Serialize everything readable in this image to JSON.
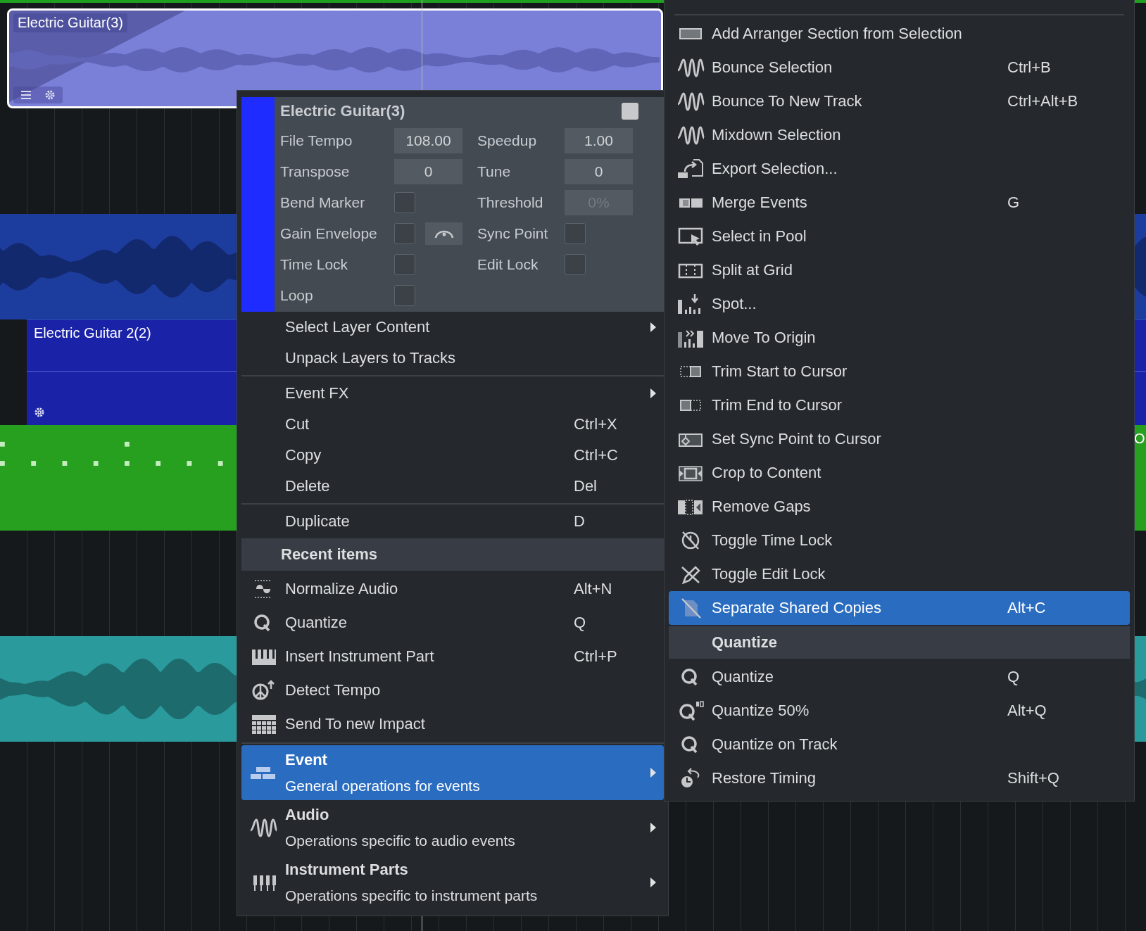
{
  "tracks": [
    {
      "kind": "event",
      "color": "#7a80d8",
      "label": "Electric Guitar(3)",
      "selected": true
    },
    {
      "kind": "empty"
    },
    {
      "kind": "waveform",
      "color": "#1c3c9e"
    },
    {
      "kind": "part",
      "color": "#1a22a8",
      "label": "Electric Guitar 2(2)"
    },
    {
      "kind": "notes",
      "color": "#27a020",
      "edge_label": "O"
    },
    {
      "kind": "empty"
    },
    {
      "kind": "waveform",
      "color": "#2a9a9c"
    },
    {
      "kind": "empty"
    }
  ],
  "event_panel": {
    "title": "Electric Guitar(3)",
    "color": "#1f2cff",
    "fields": [
      {
        "label": "File Tempo",
        "kind": "value",
        "value": "108.00",
        "disabled": false
      },
      {
        "label": "Speedup",
        "kind": "value",
        "value": "1.00",
        "disabled": false
      },
      {
        "label": "Transpose",
        "kind": "value",
        "value": "0",
        "disabled": false
      },
      {
        "label": "Tune",
        "kind": "value",
        "value": "0",
        "disabled": false
      },
      {
        "label": "Bend Marker",
        "kind": "checkbox",
        "checked": false
      },
      {
        "label": "Threshold",
        "kind": "value",
        "value": "0%",
        "disabled": true
      },
      {
        "label": "Gain Envelope",
        "kind": "checkbox",
        "checked": false,
        "curve_button": true
      },
      {
        "label": "Sync Point",
        "kind": "checkbox",
        "checked": false
      },
      {
        "label": "Time Lock",
        "kind": "checkbox",
        "checked": false
      },
      {
        "label": "Edit Lock",
        "kind": "checkbox",
        "checked": false
      },
      {
        "label": "Loop",
        "kind": "checkbox",
        "checked": false
      }
    ]
  },
  "context_menu": {
    "items": [
      {
        "kind": "item",
        "label": "Select Layer Content",
        "submenu": true,
        "selected": false
      },
      {
        "kind": "item",
        "label": "Unpack Layers to Tracks",
        "submenu": false,
        "selected": false
      },
      {
        "kind": "separator"
      },
      {
        "kind": "item",
        "label": "Event FX",
        "submenu": true,
        "selected": false
      },
      {
        "kind": "item",
        "label": "Cut",
        "shortcut": "Ctrl+X",
        "submenu": false,
        "selected": false
      },
      {
        "kind": "item",
        "label": "Copy",
        "shortcut": "Ctrl+C",
        "submenu": false,
        "selected": false
      },
      {
        "kind": "item",
        "label": "Delete",
        "shortcut": "Del",
        "submenu": false,
        "selected": false
      },
      {
        "kind": "separator"
      },
      {
        "kind": "item",
        "label": "Duplicate",
        "shortcut": "D",
        "submenu": false,
        "selected": false
      },
      {
        "kind": "header",
        "label": "Recent items"
      },
      {
        "kind": "item",
        "label": "Normalize Audio",
        "shortcut": "Alt+N",
        "submenu": false,
        "selected": false
      },
      {
        "kind": "item",
        "label": "Quantize",
        "shortcut": "Q",
        "submenu": false,
        "selected": false
      },
      {
        "kind": "item",
        "label": "Insert Instrument Part",
        "shortcut": "Ctrl+P",
        "submenu": false,
        "selected": false
      },
      {
        "kind": "item",
        "label": "Detect Tempo",
        "submenu": false,
        "selected": false
      },
      {
        "kind": "item",
        "label": "Send To new Impact",
        "submenu": false,
        "selected": false
      },
      {
        "kind": "separator"
      },
      {
        "kind": "category",
        "label": "Event",
        "description": "General operations for events",
        "submenu": true,
        "selected": true
      },
      {
        "kind": "category",
        "label": "Audio",
        "description": "Operations specific to audio events",
        "submenu": true,
        "selected": false
      },
      {
        "kind": "category",
        "label": "Instrument Parts",
        "description": "Operations specific to instrument parts",
        "submenu": true,
        "selected": false
      }
    ]
  },
  "submenu": {
    "items": [
      {
        "kind": "separator"
      },
      {
        "kind": "item",
        "label": "Add Arranger Section from Selection",
        "selected": false
      },
      {
        "kind": "item",
        "label": "Bounce Selection",
        "shortcut": "Ctrl+B",
        "selected": false
      },
      {
        "kind": "item",
        "label": "Bounce To New Track",
        "shortcut": "Ctrl+Alt+B",
        "selected": false
      },
      {
        "kind": "item",
        "label": "Mixdown Selection",
        "selected": false
      },
      {
        "kind": "item",
        "label": "Export Selection...",
        "selected": false
      },
      {
        "kind": "item",
        "label": "Merge Events",
        "shortcut": "G",
        "selected": false
      },
      {
        "kind": "item",
        "label": "Select in Pool",
        "selected": false
      },
      {
        "kind": "item",
        "label": "Split at Grid",
        "selected": false
      },
      {
        "kind": "item",
        "label": "Spot...",
        "selected": false
      },
      {
        "kind": "item",
        "label": "Move To Origin",
        "selected": false
      },
      {
        "kind": "item",
        "label": "Trim Start to Cursor",
        "selected": false
      },
      {
        "kind": "item",
        "label": "Trim End to Cursor",
        "selected": false
      },
      {
        "kind": "item",
        "label": "Set Sync Point to Cursor",
        "selected": false
      },
      {
        "kind": "item",
        "label": "Crop to Content",
        "selected": false
      },
      {
        "kind": "item",
        "label": "Remove Gaps",
        "selected": false
      },
      {
        "kind": "item",
        "label": "Toggle Time Lock",
        "selected": false
      },
      {
        "kind": "item",
        "label": "Toggle Edit Lock",
        "selected": false
      },
      {
        "kind": "item",
        "label": "Separate Shared Copies",
        "shortcut": "Alt+C",
        "selected": true
      },
      {
        "kind": "header",
        "label": "Quantize"
      },
      {
        "kind": "item",
        "label": "Quantize",
        "shortcut": "Q",
        "selected": false
      },
      {
        "kind": "item",
        "label": "Quantize 50%",
        "shortcut": "Alt+Q",
        "selected": false
      },
      {
        "kind": "item",
        "label": "Quantize on Track",
        "selected": false
      },
      {
        "kind": "item",
        "label": "Restore Timing",
        "shortcut": "Shift+Q",
        "selected": false
      }
    ]
  }
}
